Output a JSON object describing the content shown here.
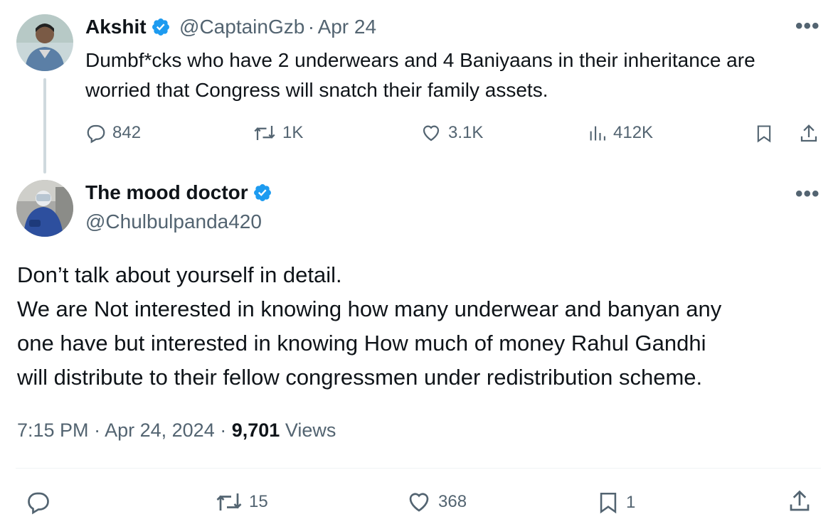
{
  "parent_tweet": {
    "name": "Akshit",
    "handle": "@CaptainGzb",
    "separator": "·",
    "date": "Apr 24",
    "text_line1": "Dumbf*cks who have 2 underwears and 4 Baniyaans in their inheritance are",
    "text_line2": "worried that Congress will snatch their family assets.",
    "stats": {
      "replies": "842",
      "reposts": "1K",
      "likes": "3.1K",
      "views": "412K"
    }
  },
  "main_tweet": {
    "name": "The mood doctor",
    "handle": "@Chulbulpanda420",
    "text_line1": "Don’t talk about yourself in detail.",
    "text_line2": "We are Not interested in knowing how many underwear and banyan any",
    "text_line3": "one have but interested in knowing How much of money Rahul Gandhi",
    "text_line4": "will distribute to their fellow congressmen under redistribution scheme.",
    "time": "7:15 PM",
    "date": "Apr 24, 2024",
    "separator": "·",
    "views_count": "9,701",
    "views_label": "Views",
    "stats": {
      "reposts": "15",
      "likes": "368",
      "bookmarks": "1"
    }
  },
  "icons": {
    "more": "•••",
    "verified_color": "#1d9bf0"
  }
}
